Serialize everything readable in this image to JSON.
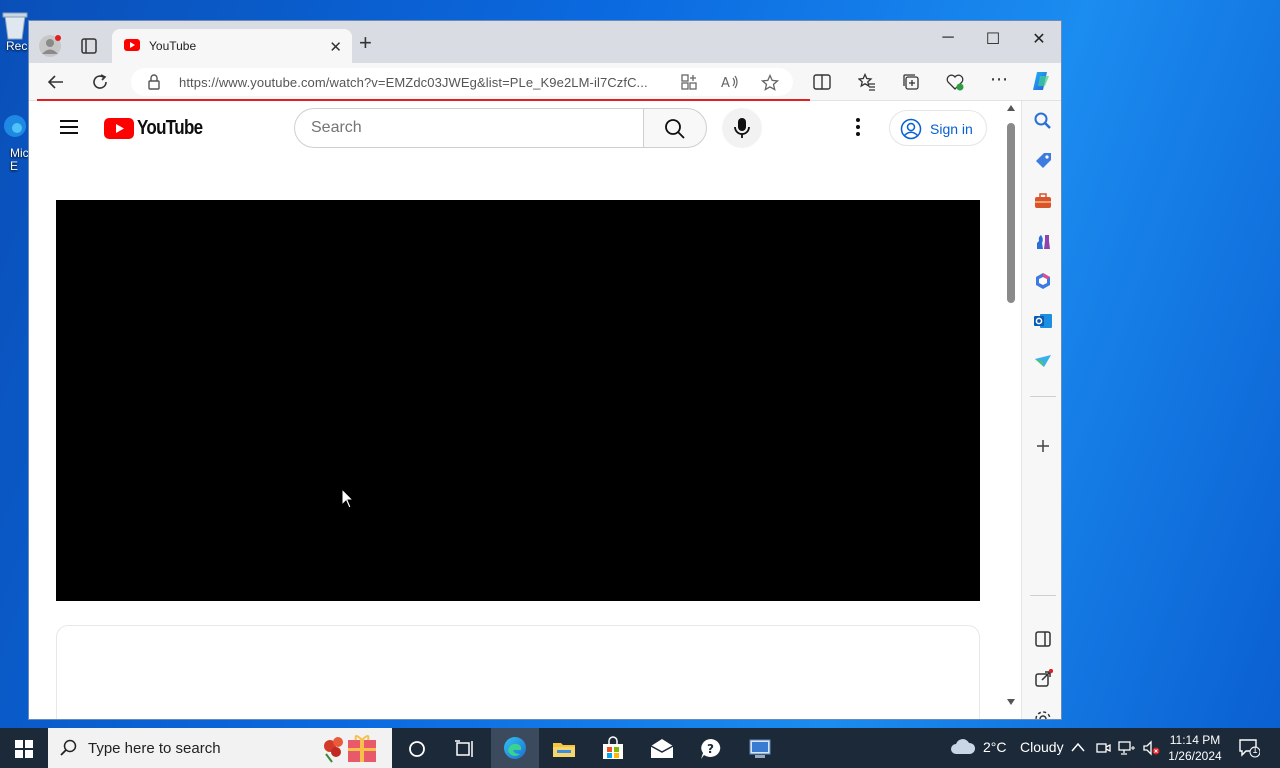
{
  "desktop": {
    "icons": [
      {
        "label": "Rec"
      },
      {
        "label": "Mic\nE"
      }
    ]
  },
  "browser": {
    "tab": {
      "title": "YouTube",
      "favicon": "youtube-icon"
    },
    "window_controls": {
      "minimize": "─",
      "maximize": "☐",
      "close": "✕"
    },
    "address_bar": {
      "url": "https://www.youtube.com/watch?v=EMZdc03JWEg&list=PLe_K9e2LM-il7CzfC..."
    },
    "loading_color": "#e02020"
  },
  "youtube": {
    "logo_text": "YouTube",
    "search_placeholder": "Search",
    "signin_label": "Sign in",
    "accent_color": "#065fd4",
    "brand_red": "#ff0000"
  },
  "taskbar": {
    "search_placeholder": "Type here to search",
    "weather": {
      "temp": "2°C",
      "condition": "Cloudy"
    },
    "clock": {
      "time": "11:14 PM",
      "date": "1/26/2024"
    },
    "notification_count": "1"
  }
}
